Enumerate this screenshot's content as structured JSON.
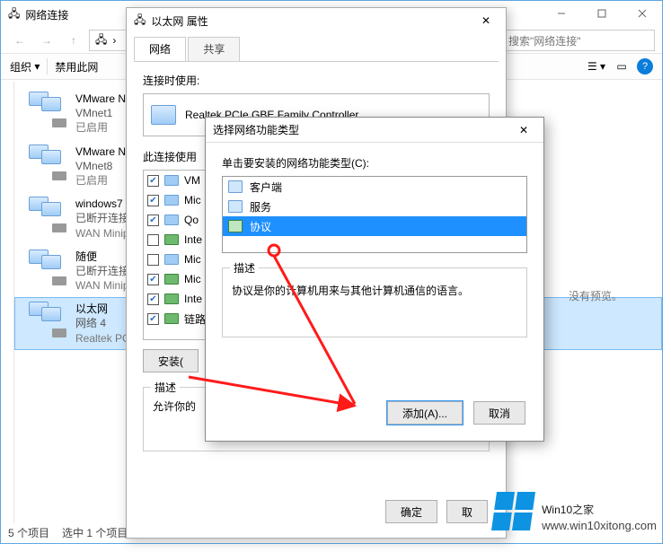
{
  "explorer": {
    "title": "网络连接",
    "search_placeholder": "搜索\"网络连接\"",
    "toolbar": {
      "org": "组织",
      "disable": "禁用此网"
    },
    "preview_empty": "没有预览。",
    "status_items": "5 个项目",
    "status_sel": "选中 1 个项目",
    "connections": [
      {
        "name": "VMware Ne",
        "sub": "VMnet1",
        "state": "已启用"
      },
      {
        "name": "VMware Ne",
        "sub": "VMnet8",
        "state": "已启用"
      },
      {
        "name": "windows7",
        "sub": "已断开连接",
        "state": "WAN Minip"
      },
      {
        "name": "随便",
        "sub": "已断开连接",
        "state": "WAN Minip"
      },
      {
        "name": "以太网",
        "sub": "网络 4",
        "state": "Realtek PCI"
      }
    ]
  },
  "props": {
    "title": "以太网 属性",
    "tab_net": "网络",
    "tab_share": "共享",
    "connect_using": "连接时使用:",
    "adapter": "Realtek PCIe GBE Family Controller",
    "list_label": "此连接使用",
    "items": [
      {
        "c": true,
        "t": "VM"
      },
      {
        "c": true,
        "t": "Mic"
      },
      {
        "c": true,
        "t": "Qo"
      },
      {
        "c": false,
        "t": "Inte"
      },
      {
        "c": false,
        "t": "Mic"
      },
      {
        "c": true,
        "t": "Mic"
      },
      {
        "c": true,
        "t": "Inte"
      },
      {
        "c": true,
        "t": "链路"
      }
    ],
    "install": "安装(",
    "desc_title": "描述",
    "desc_text": "允许你的",
    "ok": "确定",
    "cancel": "取"
  },
  "feat": {
    "title": "选择网络功能类型",
    "list_label": "单击要安装的网络功能类型(C):",
    "options": [
      {
        "icon": "b",
        "label": "客户端"
      },
      {
        "icon": "b",
        "label": "服务"
      },
      {
        "icon": "g",
        "label": "协议"
      }
    ],
    "desc_title": "描述",
    "desc_text": "协议是你的计算机用来与其他计算机通信的语言。",
    "add": "添加(A)...",
    "cancel": "取消"
  },
  "wm": {
    "brand": "Win10",
    "suffix": "之家",
    "url": "www.win10xitong.com"
  }
}
